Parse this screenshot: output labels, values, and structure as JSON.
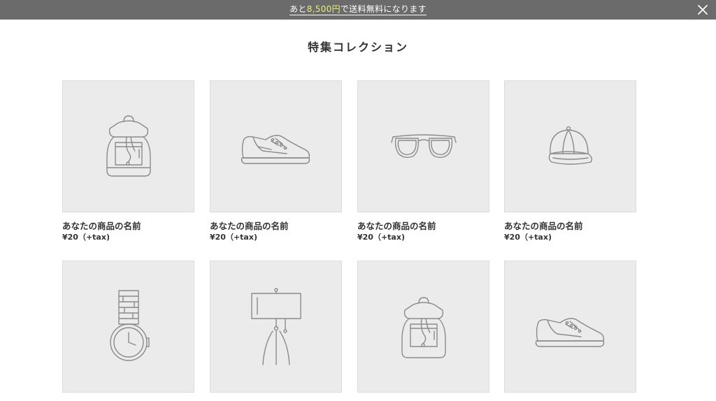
{
  "banner": {
    "prefix": "あと",
    "amount": "8,500円",
    "suffix": "で送料無料になります",
    "highlight_color": "#e6ee7a",
    "background": "#6b6b6b",
    "close_icon": "close-icon"
  },
  "section": {
    "title": "特集コレクション"
  },
  "products": [
    {
      "name": "あなたの商品の名前",
      "price": "¥20（+tax)",
      "icon": "backpack-icon"
    },
    {
      "name": "あなたの商品の名前",
      "price": "¥20（+tax)",
      "icon": "sneaker-icon"
    },
    {
      "name": "あなたの商品の名前",
      "price": "¥20（+tax)",
      "icon": "sunglasses-icon"
    },
    {
      "name": "あなたの商品の名前",
      "price": "¥20（+tax)",
      "icon": "cap-icon"
    },
    {
      "name": "",
      "price": "",
      "icon": "watch-icon"
    },
    {
      "name": "",
      "price": "",
      "icon": "lamp-icon"
    },
    {
      "name": "",
      "price": "",
      "icon": "backpack-icon"
    },
    {
      "name": "",
      "price": "",
      "icon": "sneaker-icon"
    }
  ]
}
